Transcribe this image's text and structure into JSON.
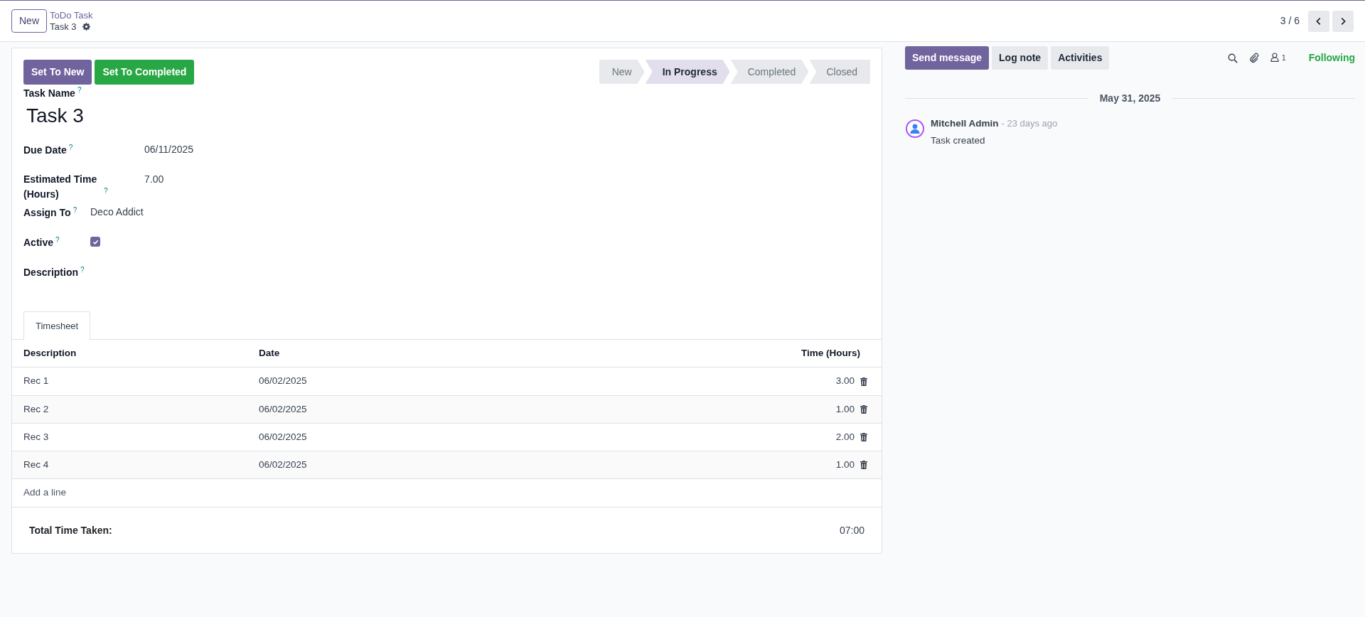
{
  "control_panel": {
    "new_button": "New",
    "breadcrumb": {
      "parent": "ToDo Task",
      "current": "Task 3"
    },
    "pager": "3 / 6"
  },
  "header_buttons": [
    {
      "label": "Set To New",
      "kind": "primary"
    },
    {
      "label": "Set To Completed",
      "kind": "success"
    }
  ],
  "stages": [
    {
      "label": "New",
      "selected": false
    },
    {
      "label": "In Progress",
      "selected": true
    },
    {
      "label": "Completed",
      "selected": false
    },
    {
      "label": "Closed",
      "selected": false
    }
  ],
  "task_name": {
    "label": "Task Name",
    "help": "?",
    "value": "Task 3"
  },
  "fields": [
    {
      "label": "Due Date",
      "help": "?",
      "kind": "text",
      "value": "06/11/2025"
    },
    {
      "label": "Estimated Time (Hours)",
      "help": "?",
      "kind": "text",
      "value": "7.00"
    },
    {
      "label": "Assign To",
      "help": "?",
      "kind": "text",
      "value": "Deco Addict"
    },
    {
      "label": "Active",
      "help": "?",
      "kind": "checkbox",
      "checked": true
    },
    {
      "label": "Description",
      "help": "?",
      "kind": "text"
    }
  ],
  "tabs": [
    {
      "label": "Timesheet",
      "selected": true
    }
  ],
  "table": {
    "columns": [
      "Description",
      "Date",
      "Time (Hours)"
    ],
    "rows": [
      [
        "Rec 1",
        "06/02/2025",
        "3.00"
      ],
      [
        "Rec 2",
        "06/02/2025",
        "1.00"
      ],
      [
        "Rec 3",
        "06/02/2025",
        "2.00"
      ],
      [
        "Rec 4",
        "06/02/2025",
        "1.00"
      ]
    ],
    "add_line": "Add a line"
  },
  "total": {
    "label": "Total Time Taken:",
    "value": "07:00"
  },
  "chatter": {
    "buttons": [
      {
        "label": "Send message",
        "kind": "primary"
      },
      {
        "label": "Log note",
        "kind": "secondary"
      },
      {
        "label": "Activities",
        "kind": "secondary"
      }
    ],
    "followers_count": "1",
    "following": "Following",
    "date": "May 31, 2025",
    "messages": [
      {
        "author": "Mitchell Admin",
        "time": "- 23 days ago",
        "body": "Task created"
      }
    ]
  }
}
